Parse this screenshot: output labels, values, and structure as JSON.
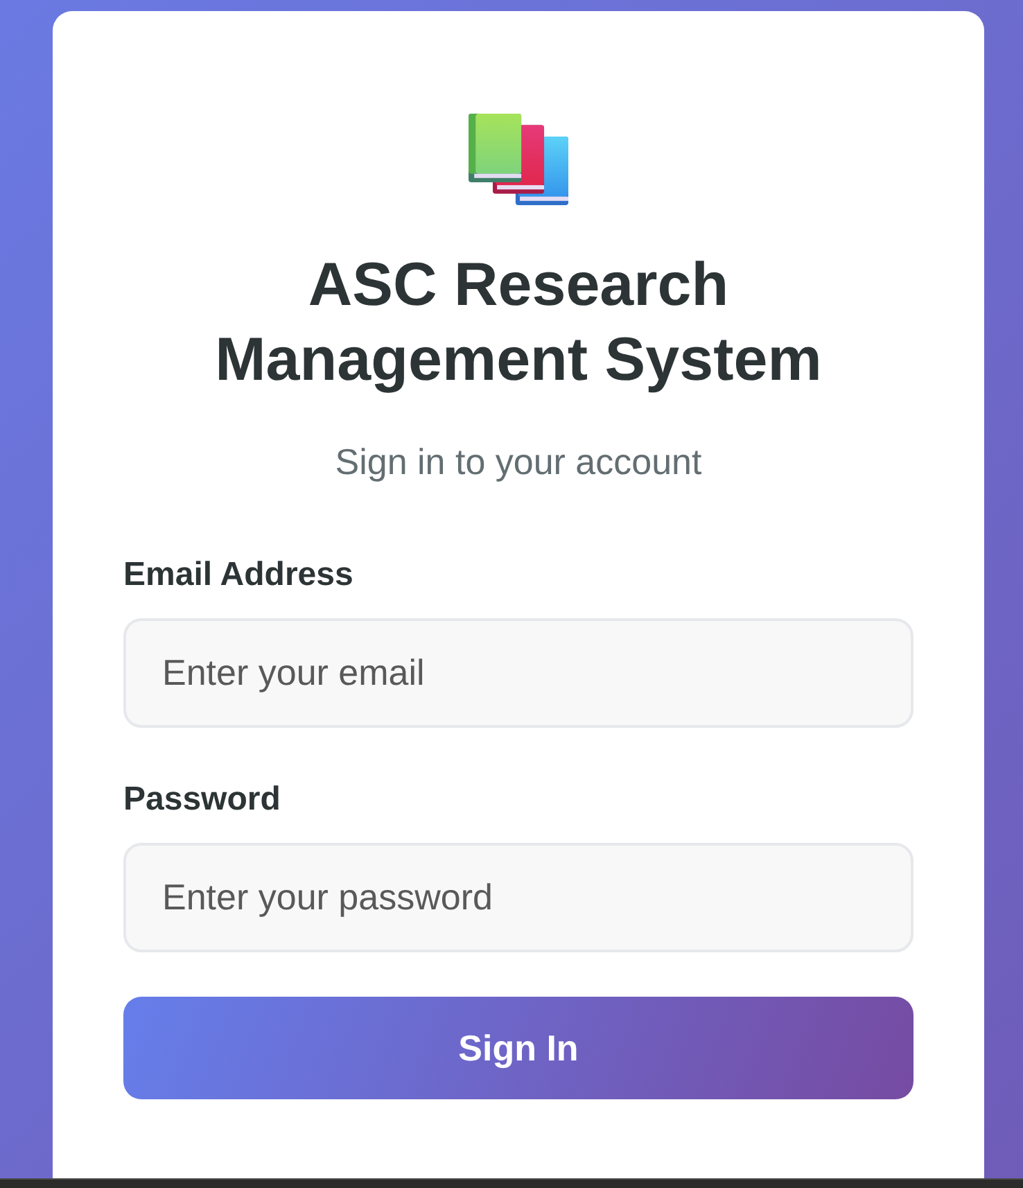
{
  "title": "ASC Research Management System",
  "subtitle": "Sign in to your account",
  "fields": [
    {
      "label": "Email Address",
      "placeholder": "Enter your email"
    },
    {
      "label": "Password",
      "placeholder": "Enter your password"
    }
  ],
  "submit_button": "Sign In"
}
